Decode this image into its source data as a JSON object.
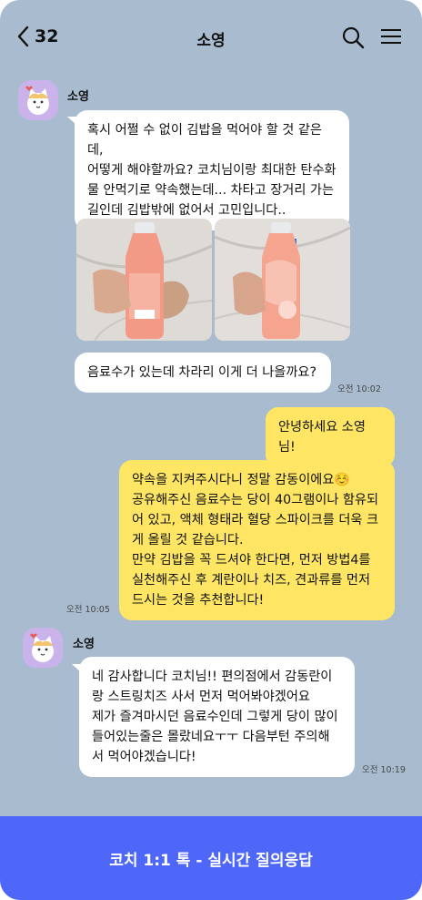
{
  "header": {
    "back_count": "32",
    "title": "소영"
  },
  "messages": {
    "m1": {
      "sender": "소영",
      "text": "혹시 어쩔 수 없이 김밥을 먹어야 할 것 같은데,\n어떻게 해야할까요? 코치님이랑 최대한 탄수화\n물 안먹기로 약속했는데... 차타고 장거리 가는\n길인데 김밥밖에 없어서 고민입니다.."
    },
    "m2": {
      "text": "음료수가 있는데 차라리 이게 더 나을까요?",
      "time": "오전 10:02"
    },
    "m3": {
      "text": "안녕하세요 소영님!"
    },
    "m4": {
      "text": "약속을 지켜주시다니 정말 감동이에요☺️\n공유해주신 음료수는 당이 40그램이나 함유되\n어 있고, 액체 형태라 혈당 스파이크를 더욱 크\n게 올릴 것 같습니다.\n만약 김밥을 꼭 드셔야 한다면, 먼저 방법4를\n실천해주신 후 계란이나 치즈, 견과류를 먼저\n드시는 것을 추천합니다!",
      "time": "오전 10:05"
    },
    "m5": {
      "sender": "소영",
      "text": "네 감사합니다 코치님!! 편의점에서 감동란이\n랑 스트링치즈 사서 먼저 먹어봐야겠어요\n제가 즐겨마시던 음료수인데 그렇게 당이 많이\n들어있는줄은 몰랐네요ㅜㅜ 다음부턴 주의해\n서 먹어야겠습니다!",
      "time": "오전 10:19"
    }
  },
  "footer": {
    "label": "코치 1:1 톡 - 실시간 질의응답"
  },
  "colors": {
    "background": "#a9bccf",
    "bubble_coach": "#fee664",
    "bubble_user": "#ffffff",
    "footer": "#4e67f8",
    "avatar_bg": "#c9b3ea"
  },
  "icons": [
    "chevron-left-icon",
    "search-icon",
    "hamburger-menu-icon",
    "cat-avatar-icon"
  ]
}
